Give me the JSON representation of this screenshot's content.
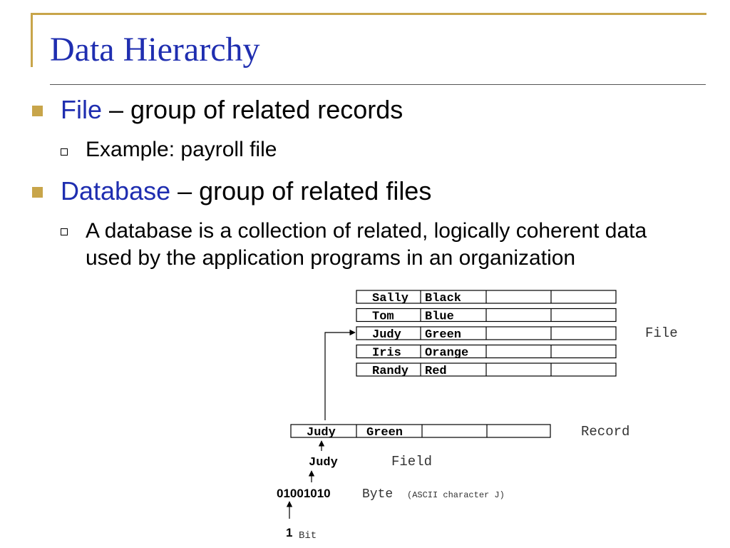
{
  "slide": {
    "title": "Data Hierarchy",
    "bullets": [
      {
        "term": "File",
        "rest": " – group of related records",
        "sub": [
          "Example: payroll file"
        ]
      },
      {
        "term": "Database",
        "rest": " – group of related files",
        "sub": [
          "A database is a collection of related, logically coherent data used by the application programs in an organization"
        ]
      }
    ]
  },
  "diagram": {
    "file_records": [
      [
        "Sally",
        "Black"
      ],
      [
        "Tom",
        "Blue"
      ],
      [
        "Judy",
        "Green"
      ],
      [
        "Iris",
        "Orange"
      ],
      [
        "Randy",
        "Red"
      ]
    ],
    "file_label": "File",
    "record": [
      "Judy",
      "Green"
    ],
    "record_label": "Record",
    "field_value": "Judy",
    "field_label": "Field",
    "byte_value": "01001010",
    "byte_label": "Byte",
    "byte_note": "(ASCII character J)",
    "bit_value": "1",
    "bit_label": "Bit"
  },
  "colors": {
    "accent": "#c8a54a",
    "title_blue": "#1f2eb0"
  }
}
